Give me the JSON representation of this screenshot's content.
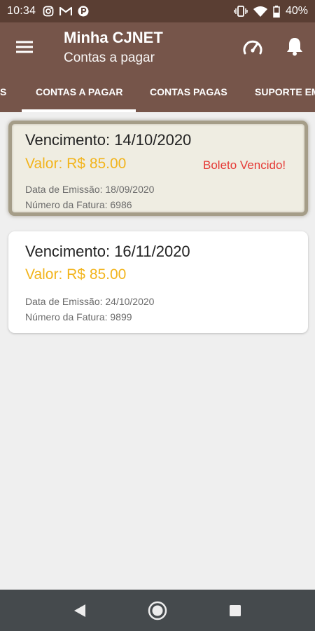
{
  "status_bar": {
    "time": "10:34",
    "battery": "40%",
    "left_icons": [
      "instagram-icon",
      "gmail-icon",
      "p-app-icon"
    ],
    "right_icons": [
      "vibrate-icon",
      "wifi-icon",
      "battery-icon"
    ]
  },
  "app_bar": {
    "title": "Minha CJNET",
    "subtitle": "Contas a pagar",
    "icons": [
      "menu-icon",
      "speedometer-icon",
      "bell-icon"
    ]
  },
  "tabs": {
    "items": [
      {
        "label": "S"
      },
      {
        "label": "CONTAS A PAGAR",
        "active": true
      },
      {
        "label": "CONTAS PAGAS"
      },
      {
        "label": "SUPORTE EM"
      }
    ]
  },
  "bills": [
    {
      "due": "Vencimento: 14/10/2020",
      "value": "Valor: R$ 85.00",
      "status": "Boleto Vencido!",
      "issue_date": "Data de Emissão: 18/09/2020",
      "invoice": "Número da Fatura: 6986"
    },
    {
      "due": "Vencimento: 16/11/2020",
      "value": "Valor: R$ 85.00",
      "issue_date": "Data de Emissão: 24/10/2020",
      "invoice": "Número da Fatura: 9899"
    }
  ],
  "colors": {
    "status_bar": "#5a3e33",
    "app_bar": "#76554a",
    "value": "#f2b41c",
    "overdue": "#e53935",
    "background": "#efefef",
    "nav_bar": "#454a4d"
  },
  "nav_bar": {
    "icons": [
      "back-icon",
      "home-icon",
      "recents-icon"
    ]
  }
}
